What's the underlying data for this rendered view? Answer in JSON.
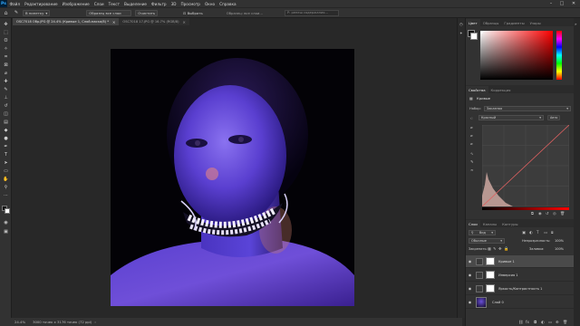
{
  "menubar": {
    "logo": "Ps",
    "items": [
      "Файл",
      "Редактирование",
      "Изображение",
      "Слои",
      "Текст",
      "Выделение",
      "Фильтр",
      "3D",
      "Просмотр",
      "Окно",
      "Справка"
    ],
    "minimize": "–",
    "maximize": "□",
    "close": "✕"
  },
  "options": {
    "home_icon": "home-icon",
    "tool_icon": "brush-icon",
    "sample_size": "В пипетку",
    "sample_all": "Образец все слои",
    "clear_btn": "Очистить",
    "select_btn": "Выбрать",
    "sample_text": "Образец: все слои...",
    "search_placeholder": "Р: ренеш содержания..."
  },
  "doctabs": [
    {
      "label": "OSC7018 Обр.JPG @ 24.4% (Кривые 1, Слой-маска/8) *",
      "close": "×"
    },
    {
      "label": "OSC7018 17.JPG @ 16.7% (RGB/8)",
      "close": "×"
    }
  ],
  "status": {
    "zoom": "24.4%",
    "info": "3000 точек x 3176 точек (72 ppi)"
  },
  "color_panel": {
    "tabs": [
      "Цвет",
      "Образцы",
      "Градиенты",
      "Узоры"
    ],
    "hue_colors": [
      "#ff0000",
      "#ff00ff",
      "#0000ff",
      "#00ffff",
      "#00ff00",
      "#ffff00",
      "#ff0000"
    ],
    "field_hue": "#ff0000"
  },
  "properties_panel": {
    "tabs": [
      "Свойства",
      "Коррекция"
    ],
    "type_label": "Кривые",
    "preset_label": "Набор:",
    "preset_value": "Заказная",
    "channel_value": "Красный",
    "auto_btn": "Авто",
    "curve_color": "#e06060"
  },
  "layers_panel": {
    "tabs": [
      "Слои",
      "Каналы",
      "Контуры"
    ],
    "filter_label": "Вид",
    "blend_mode": "Обычные",
    "opacity_label": "Непрозрачность:",
    "opacity_value": "100%",
    "lock_label": "Закрепить:",
    "fill_label": "Заливка:",
    "fill_value": "100%",
    "layers": [
      {
        "name": "Кривые 1",
        "selected": true
      },
      {
        "name": "Инверсия 1",
        "selected": false
      },
      {
        "name": "Яркость/Контрастность 1",
        "selected": false
      },
      {
        "name": "Слой 0",
        "selected": false
      }
    ]
  }
}
